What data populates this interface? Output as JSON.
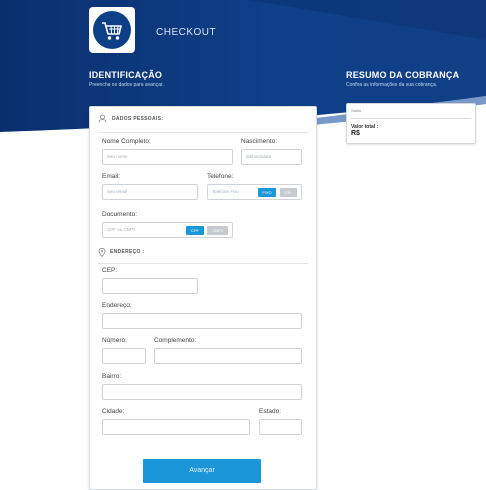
{
  "header": {
    "title": "CHECKOUT",
    "brand_color": "#0d3f86"
  },
  "identification": {
    "title": "IDENTIFICAÇÃO",
    "subtitle": "Preencha os dados para avançar."
  },
  "billing_summary": {
    "title": "RESUMO DA COBRANÇA",
    "subtitle": "Confira as informações da sua cobrança.",
    "item_label": "Saldo",
    "total_label": "Valor total :",
    "total_value": "R$"
  },
  "personal": {
    "heading": "DADOS PESSOAIS:",
    "full_name_label": "Nome Completo:",
    "full_name_placeholder": "Seu nome",
    "birth_label": "Nascimento:",
    "birth_placeholder": "dd/mm/aaaa",
    "email_label": "Email:",
    "email_placeholder": "Seu email",
    "phone_label": "Telefone:",
    "phone_placeholder": "Telefone Fixo",
    "phone_types": [
      "FIXO",
      "CEL"
    ],
    "document_label": "Documento:",
    "document_placeholder": "CPF ou CNPJ",
    "document_types": [
      "CPF",
      "CNPJ"
    ]
  },
  "address": {
    "heading": "ENDEREÇO :",
    "cep_label": "CEP:",
    "street_label": "Endereço:",
    "number_label": "Número:",
    "complement_label": "Complemento:",
    "district_label": "Bairro:",
    "city_label": "Cidade:",
    "state_label": "Estado:"
  },
  "actions": {
    "submit_label": "Avançar"
  }
}
